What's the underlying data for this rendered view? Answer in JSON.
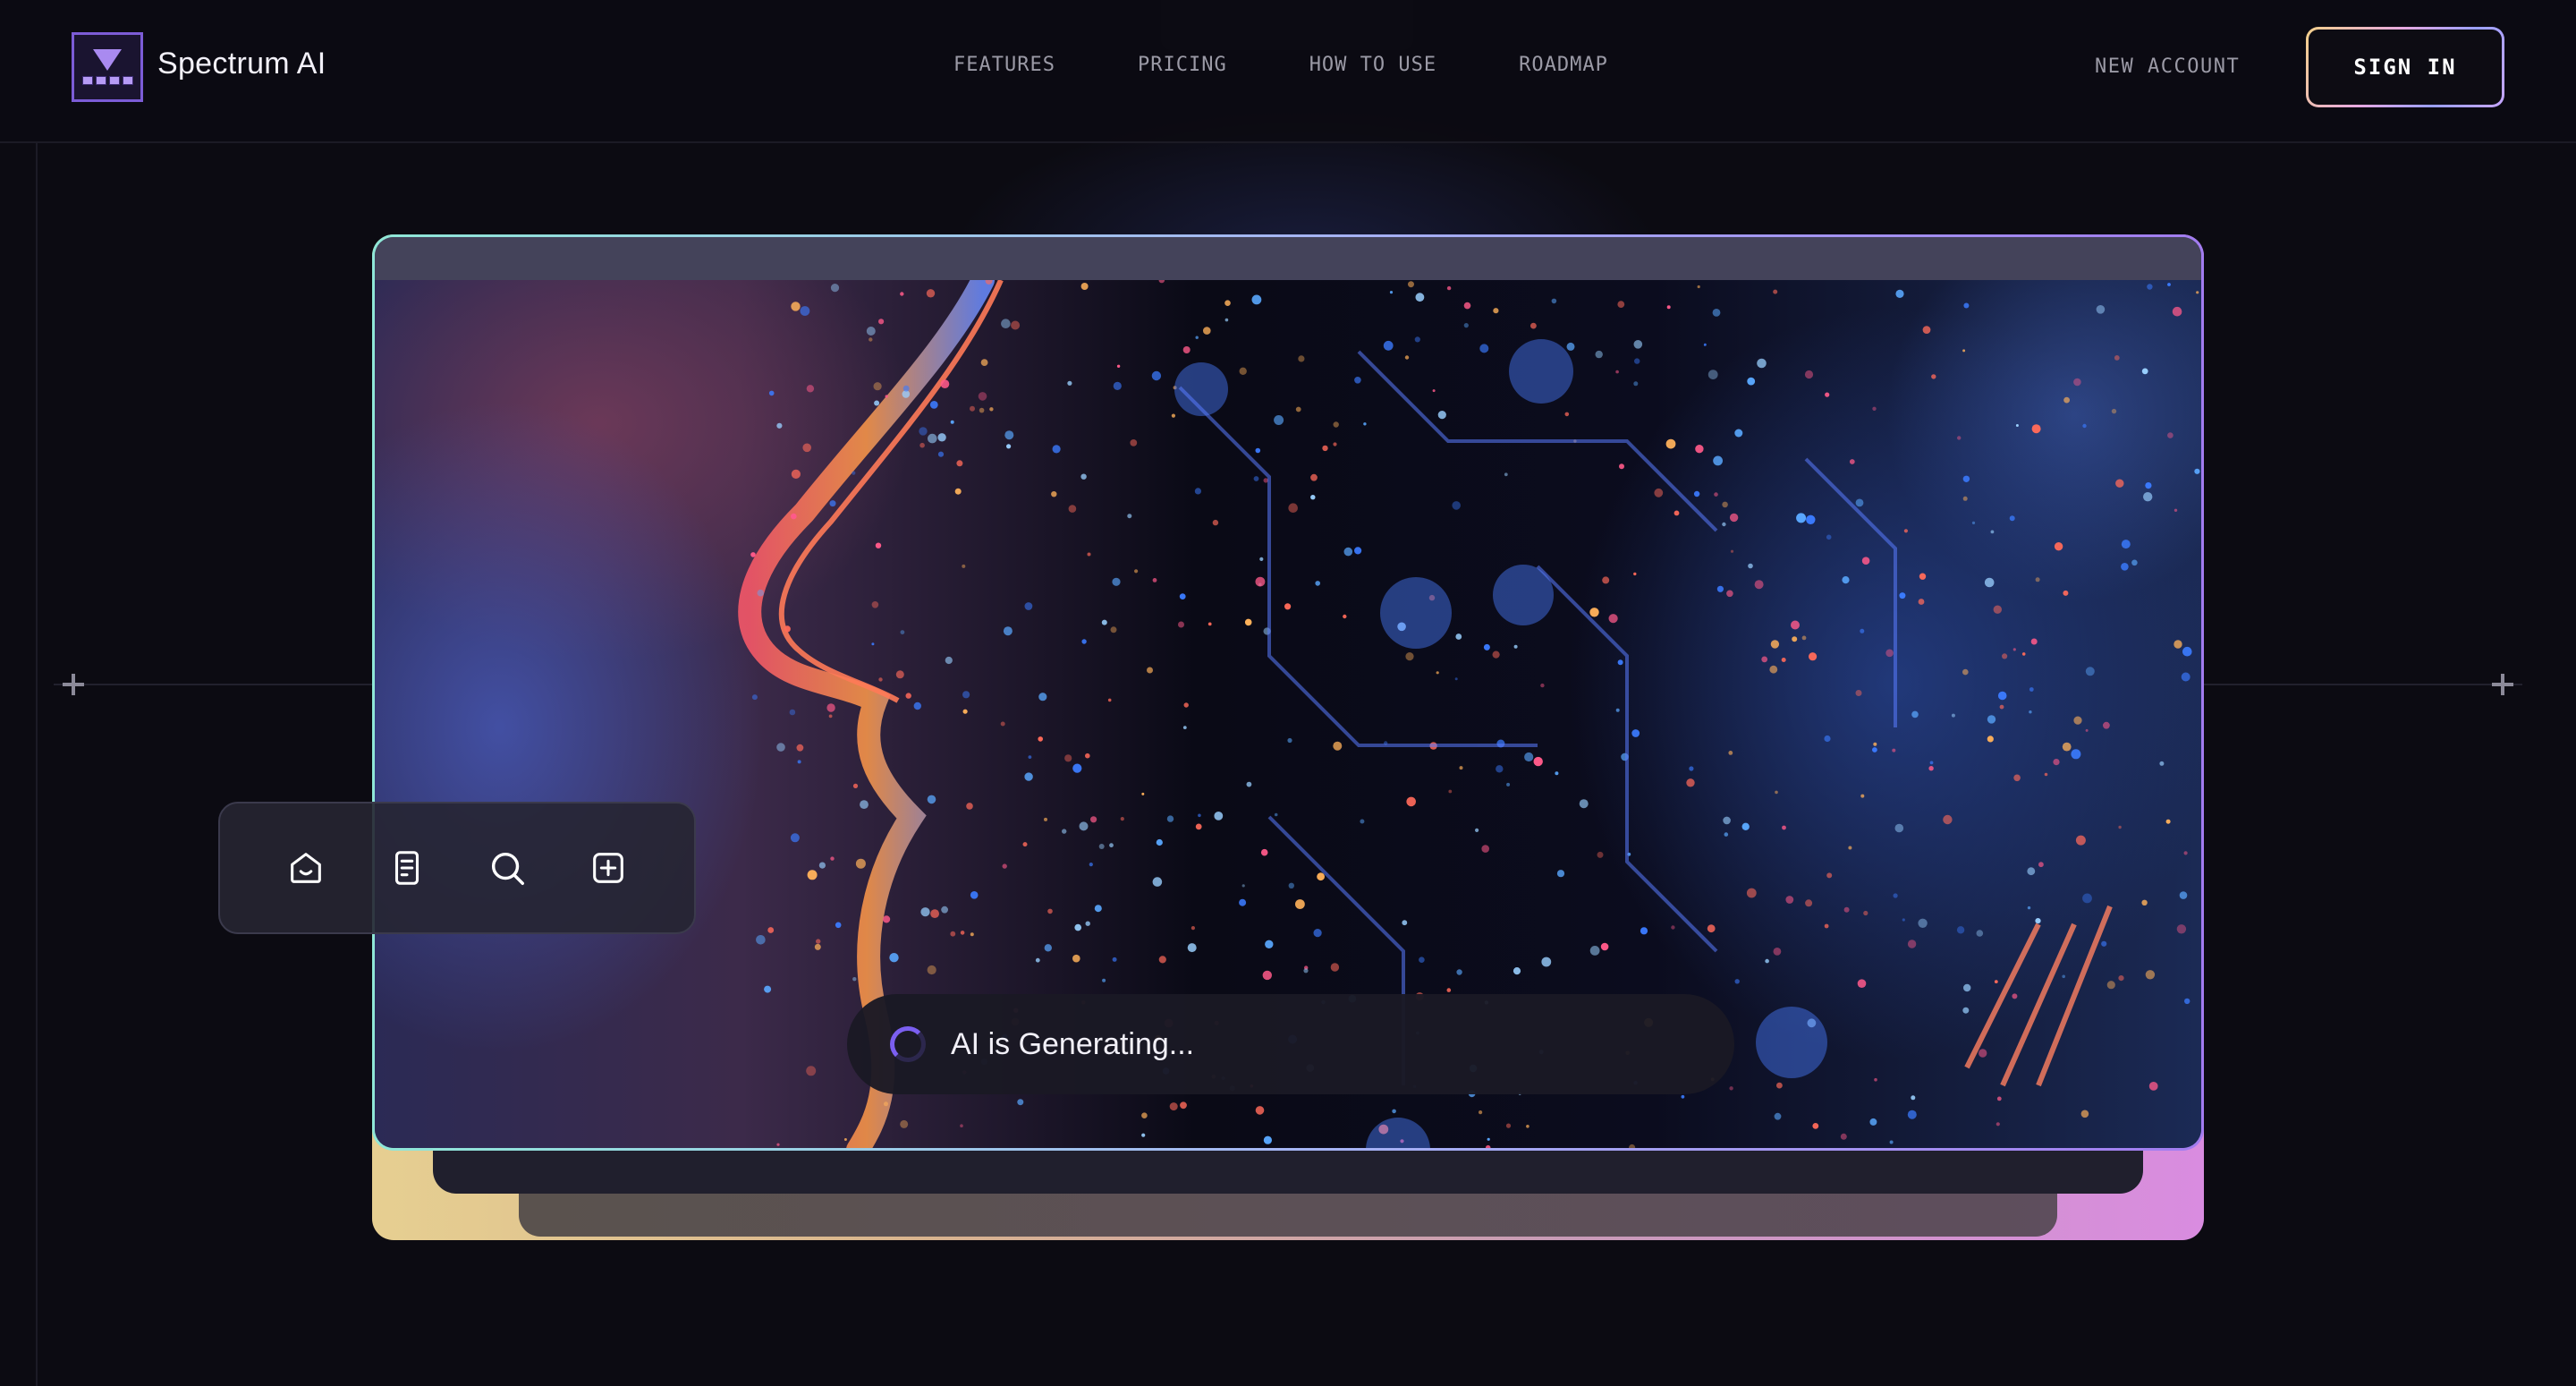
{
  "brand": {
    "name": "Spectrum AI",
    "logo_icon": "gem-film-logo-icon",
    "accent_color": "#7c5cd6"
  },
  "nav": {
    "items": [
      {
        "label": "FEATURES"
      },
      {
        "label": "PRICING"
      },
      {
        "label": "HOW TO USE"
      },
      {
        "label": "ROADMAP"
      }
    ],
    "new_account_label": "NEW ACCOUNT",
    "sign_in_label": "SIGN IN"
  },
  "hero": {
    "image_description_icon": "ai-face-circuit-image",
    "toolbar": {
      "buttons": [
        {
          "icon": "home-icon"
        },
        {
          "icon": "document-icon"
        },
        {
          "icon": "search-icon"
        },
        {
          "icon": "add-square-icon"
        }
      ]
    },
    "status": {
      "text": "AI is Generating...",
      "icon": "spinner-icon",
      "spinner_color": "#7b5ff0"
    }
  }
}
